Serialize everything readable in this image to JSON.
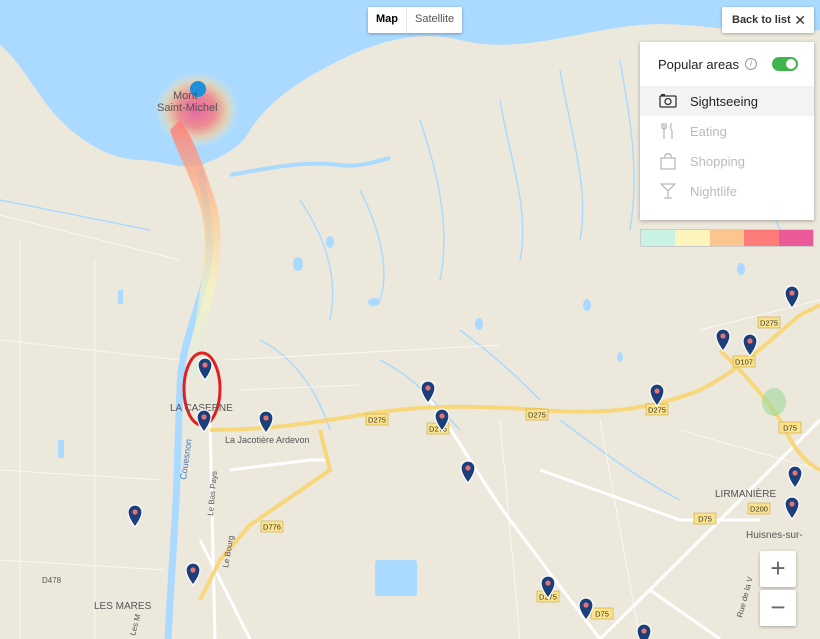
{
  "map_type": {
    "map_label": "Map",
    "satellite_label": "Satellite",
    "selected": "Map"
  },
  "back_label": "Back to list",
  "panel": {
    "title": "Popular areas",
    "info_glyph": "i",
    "toggle_on": true,
    "categories": [
      {
        "label": "Sightseeing",
        "icon": "camera-icon",
        "selected": true
      },
      {
        "label": "Eating",
        "icon": "fork-knife-icon",
        "selected": false
      },
      {
        "label": "Shopping",
        "icon": "shopping-bag-icon",
        "selected": false
      },
      {
        "label": "Nightlife",
        "icon": "cocktail-icon",
        "selected": false
      }
    ]
  },
  "legend_colors": [
    "#c9f2e3",
    "#fbf5bd",
    "#fcc58f",
    "#fb7b78",
    "#ea5a99"
  ],
  "zoom": {
    "in_label": "+",
    "out_label": "−"
  },
  "map_labels": {
    "mont_line1": "Mont",
    "mont_line2": "Saint-Michel",
    "lacaserne": "LA CASERNE",
    "jacotiere": "La Jacotière Ardevon",
    "couesnon": "Couesnon",
    "bas_pays": "Le Bas Pays",
    "le_bourg": "Le Bourg",
    "les_mares": "LES MARES",
    "lirmaniere": "LIRMANIÈRE",
    "huisnes": "Huisnes-sur-",
    "rue_de_la": "Rue de la V",
    "les_m": "Les M",
    "d478": "D478"
  },
  "road_shields": [
    "D275",
    "D275",
    "D275",
    "D275",
    "D107",
    "D75",
    "D75",
    "D200",
    "D776",
    "D275",
    "D275",
    "D75"
  ],
  "colors": {
    "water": "#aadaff",
    "land": "#ede8dc",
    "road_major": "#f8d77a",
    "road_white": "#ffffff",
    "marker": "#1a3f7a",
    "marker_dot": "#e57373"
  }
}
